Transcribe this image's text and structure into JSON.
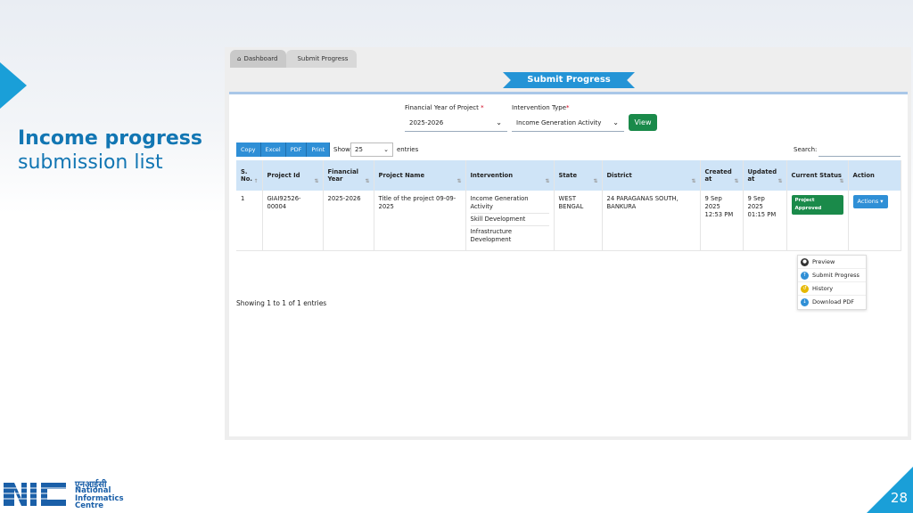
{
  "slide": {
    "title_bold": "Income progress",
    "title_light": "submission list",
    "page_number": "28",
    "logo": {
      "hindi": "एनआईसी",
      "line1": "National",
      "line2": "Informatics",
      "line3": "Centre",
      "mark": "NIC"
    }
  },
  "app": {
    "breadcrumbs": [
      {
        "label": "Dashboard",
        "icon": "home-icon"
      },
      {
        "label": "Submit Progress"
      }
    ],
    "page_heading": "Submit Progress",
    "filters": {
      "fy_label": "Financial Year of Project",
      "fy_required": "*",
      "fy_value": "2025-2026",
      "intervention_label": "Intervention Type",
      "intervention_required": "*",
      "intervention_value": "Income Generation Activity",
      "view_label": "View"
    },
    "toolbar": {
      "export_buttons": [
        "Copy",
        "Excel",
        "PDF",
        "Print"
      ],
      "show_label": "Show",
      "page_length": "25",
      "entries_label": "entries",
      "search_label": "Search:"
    },
    "table": {
      "headers": [
        "S. No.",
        "Project Id",
        "Financial Year",
        "Project Name",
        "Intervention",
        "State",
        "District",
        "Created at",
        "Updated at",
        "Current Status",
        "Action"
      ],
      "rows": [
        {
          "sno": "1",
          "project_id": "GIAI92526-00004",
          "financial_year": "2025-2026",
          "project_name": "Title of the project 09-09-2025",
          "interventions": [
            "Income Generation Activity",
            "Skill Development",
            "Infrastructure Development"
          ],
          "state": "WEST BENGAL",
          "district": "24 PARAGANAS SOUTH, BANKURA",
          "created_at": "9 Sep 2025 12:53 PM",
          "updated_at": "9 Sep 2025 01:15 PM",
          "status": "Project Approved",
          "action_label": "Actions ▾"
        }
      ],
      "footer": "Showing 1 to 1 of 1 entries"
    },
    "actions_menu": [
      {
        "label": "Preview",
        "icon": "eye-icon",
        "color": "#333333"
      },
      {
        "label": "Submit Progress",
        "icon": "upload-icon",
        "color": "#2f8fd6"
      },
      {
        "label": "History",
        "icon": "history-icon",
        "color": "#e6b800"
      },
      {
        "label": "Download PDF",
        "icon": "download-icon",
        "color": "#2f8fd6"
      }
    ],
    "colors": {
      "accent": "#1a9fd8",
      "primary_button": "#2f8fd6",
      "success": "#1a8a4a",
      "header_bg": "#cfe4f7"
    }
  }
}
